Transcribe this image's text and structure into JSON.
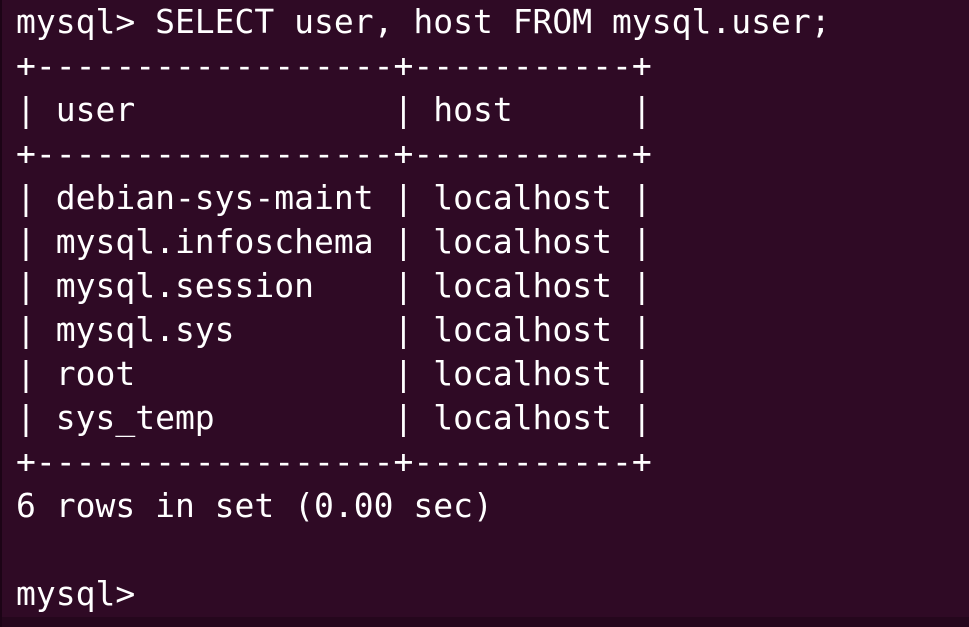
{
  "terminal": {
    "lines": [
      "mysql> SELECT user, host FROM mysql.user;",
      "+------------------+-----------+",
      "| user             | host      |",
      "+------------------+-----------+",
      "| debian-sys-maint | localhost |",
      "| mysql.infoschema | localhost |",
      "| mysql.session    | localhost |",
      "| mysql.sys        | localhost |",
      "| root             | localhost |",
      "| sys_temp         | localhost |",
      "+------------------+-----------+",
      "6 rows in set (0.00 sec)",
      "",
      "mysql> "
    ]
  },
  "colors": {
    "background": "#2f0a25",
    "foreground": "#ffffff"
  }
}
